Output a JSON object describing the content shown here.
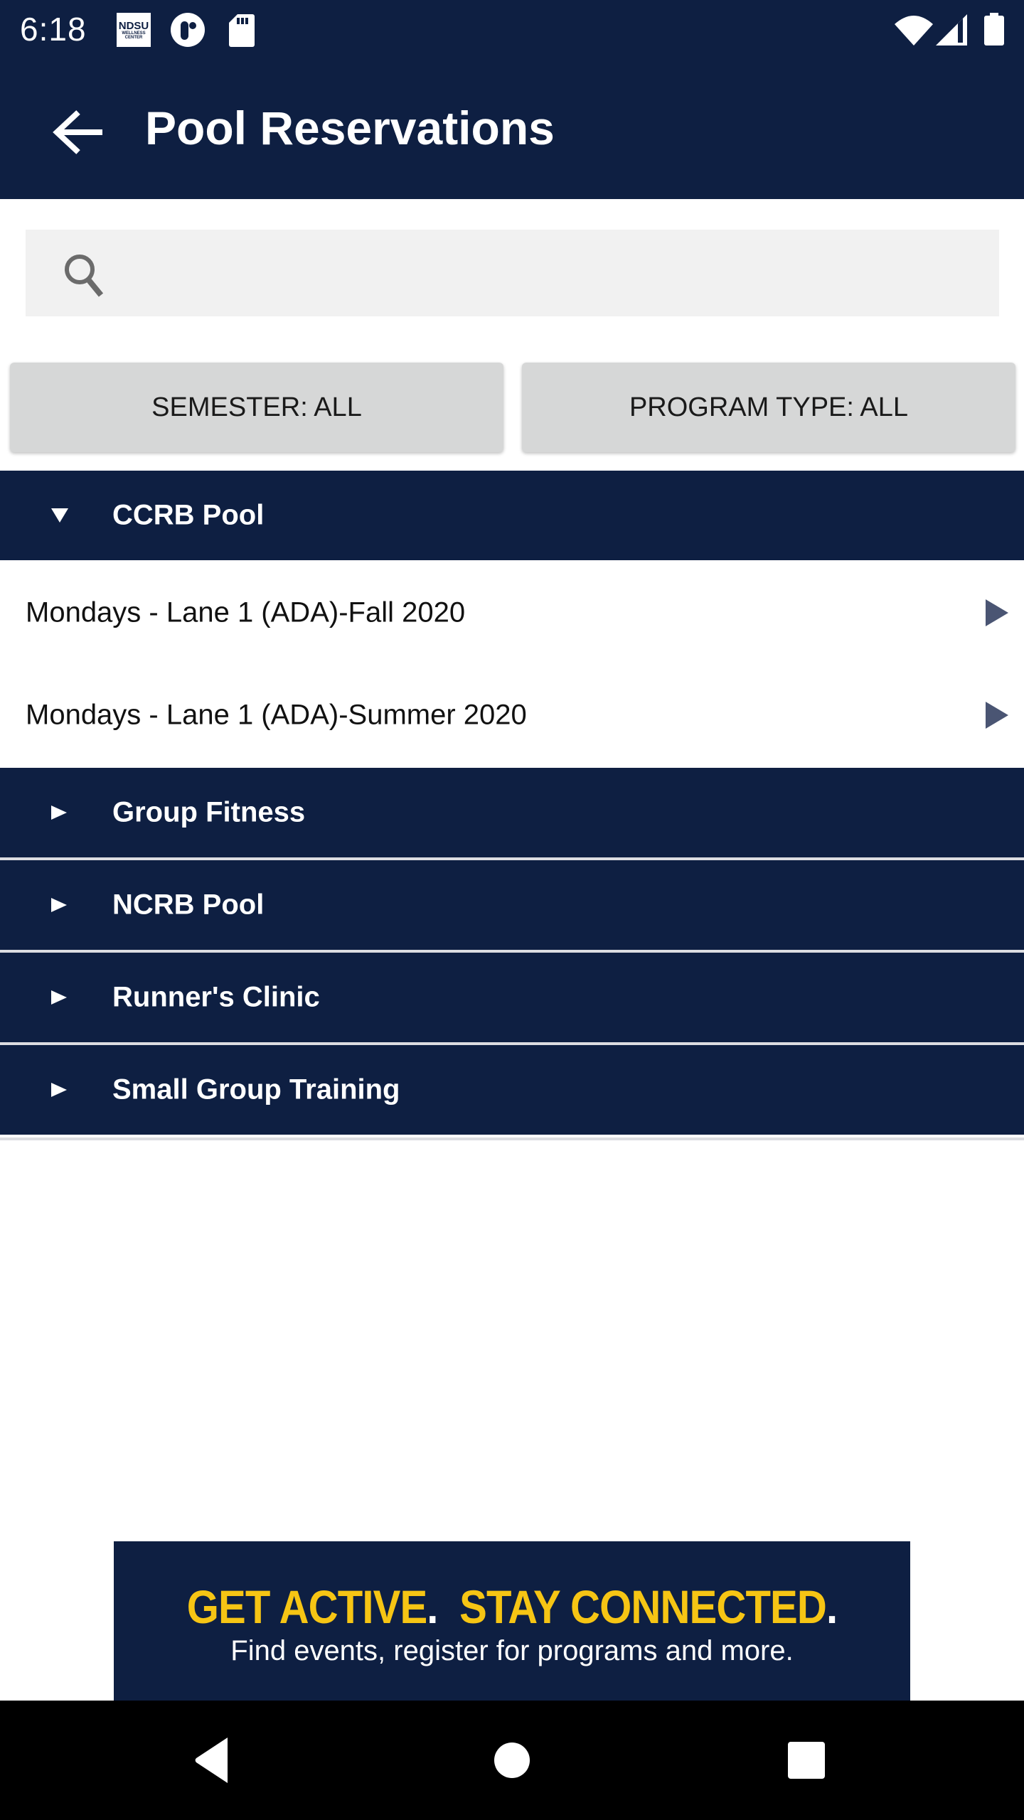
{
  "status_bar": {
    "time": "6:18",
    "left_icons": [
      "ndsu-wellness-center-app-icon",
      "app-notification-icon",
      "sd-card-icon"
    ],
    "ndsu_logo": {
      "line1": "NDSU",
      "line2": "WELLNESS",
      "line3": "CENTER"
    },
    "right_icons": [
      "wifi-icon",
      "cellular-signal-icon",
      "battery-icon"
    ]
  },
  "header": {
    "back_icon": "arrow-back-icon",
    "title": "Pool Reservations"
  },
  "search": {
    "icon": "search-icon",
    "value": "",
    "placeholder": ""
  },
  "filters": {
    "semester_label": "SEMESTER: ALL",
    "program_type_label": "PROGRAM TYPE: ALL"
  },
  "groups": [
    {
      "label": "CCRB Pool",
      "expanded": true,
      "items": [
        {
          "label": "Mondays - Lane 1 (ADA)-Fall 2020"
        },
        {
          "label": "Mondays - Lane 1 (ADA)-Summer 2020"
        }
      ]
    },
    {
      "label": "Group Fitness",
      "expanded": false
    },
    {
      "label": "NCRB Pool",
      "expanded": false
    },
    {
      "label": "Runner's Clinic",
      "expanded": false
    },
    {
      "label": "Small Group Training",
      "expanded": false
    }
  ],
  "banner": {
    "headline_part1": "GET ACTIVE",
    "headline_part2": "STAY CONNECTED",
    "subtext": "Find events, register for programs and more."
  },
  "colors": {
    "navy": "#0e1f42",
    "gold": "#f6c514",
    "filter_button": "#d6d7d7",
    "search_bg": "#f1f1f1",
    "item_arrow": "#4a5573"
  },
  "nav_bar": {
    "back": "nav-back-icon",
    "home": "nav-home-icon",
    "recents": "nav-recents-icon"
  }
}
